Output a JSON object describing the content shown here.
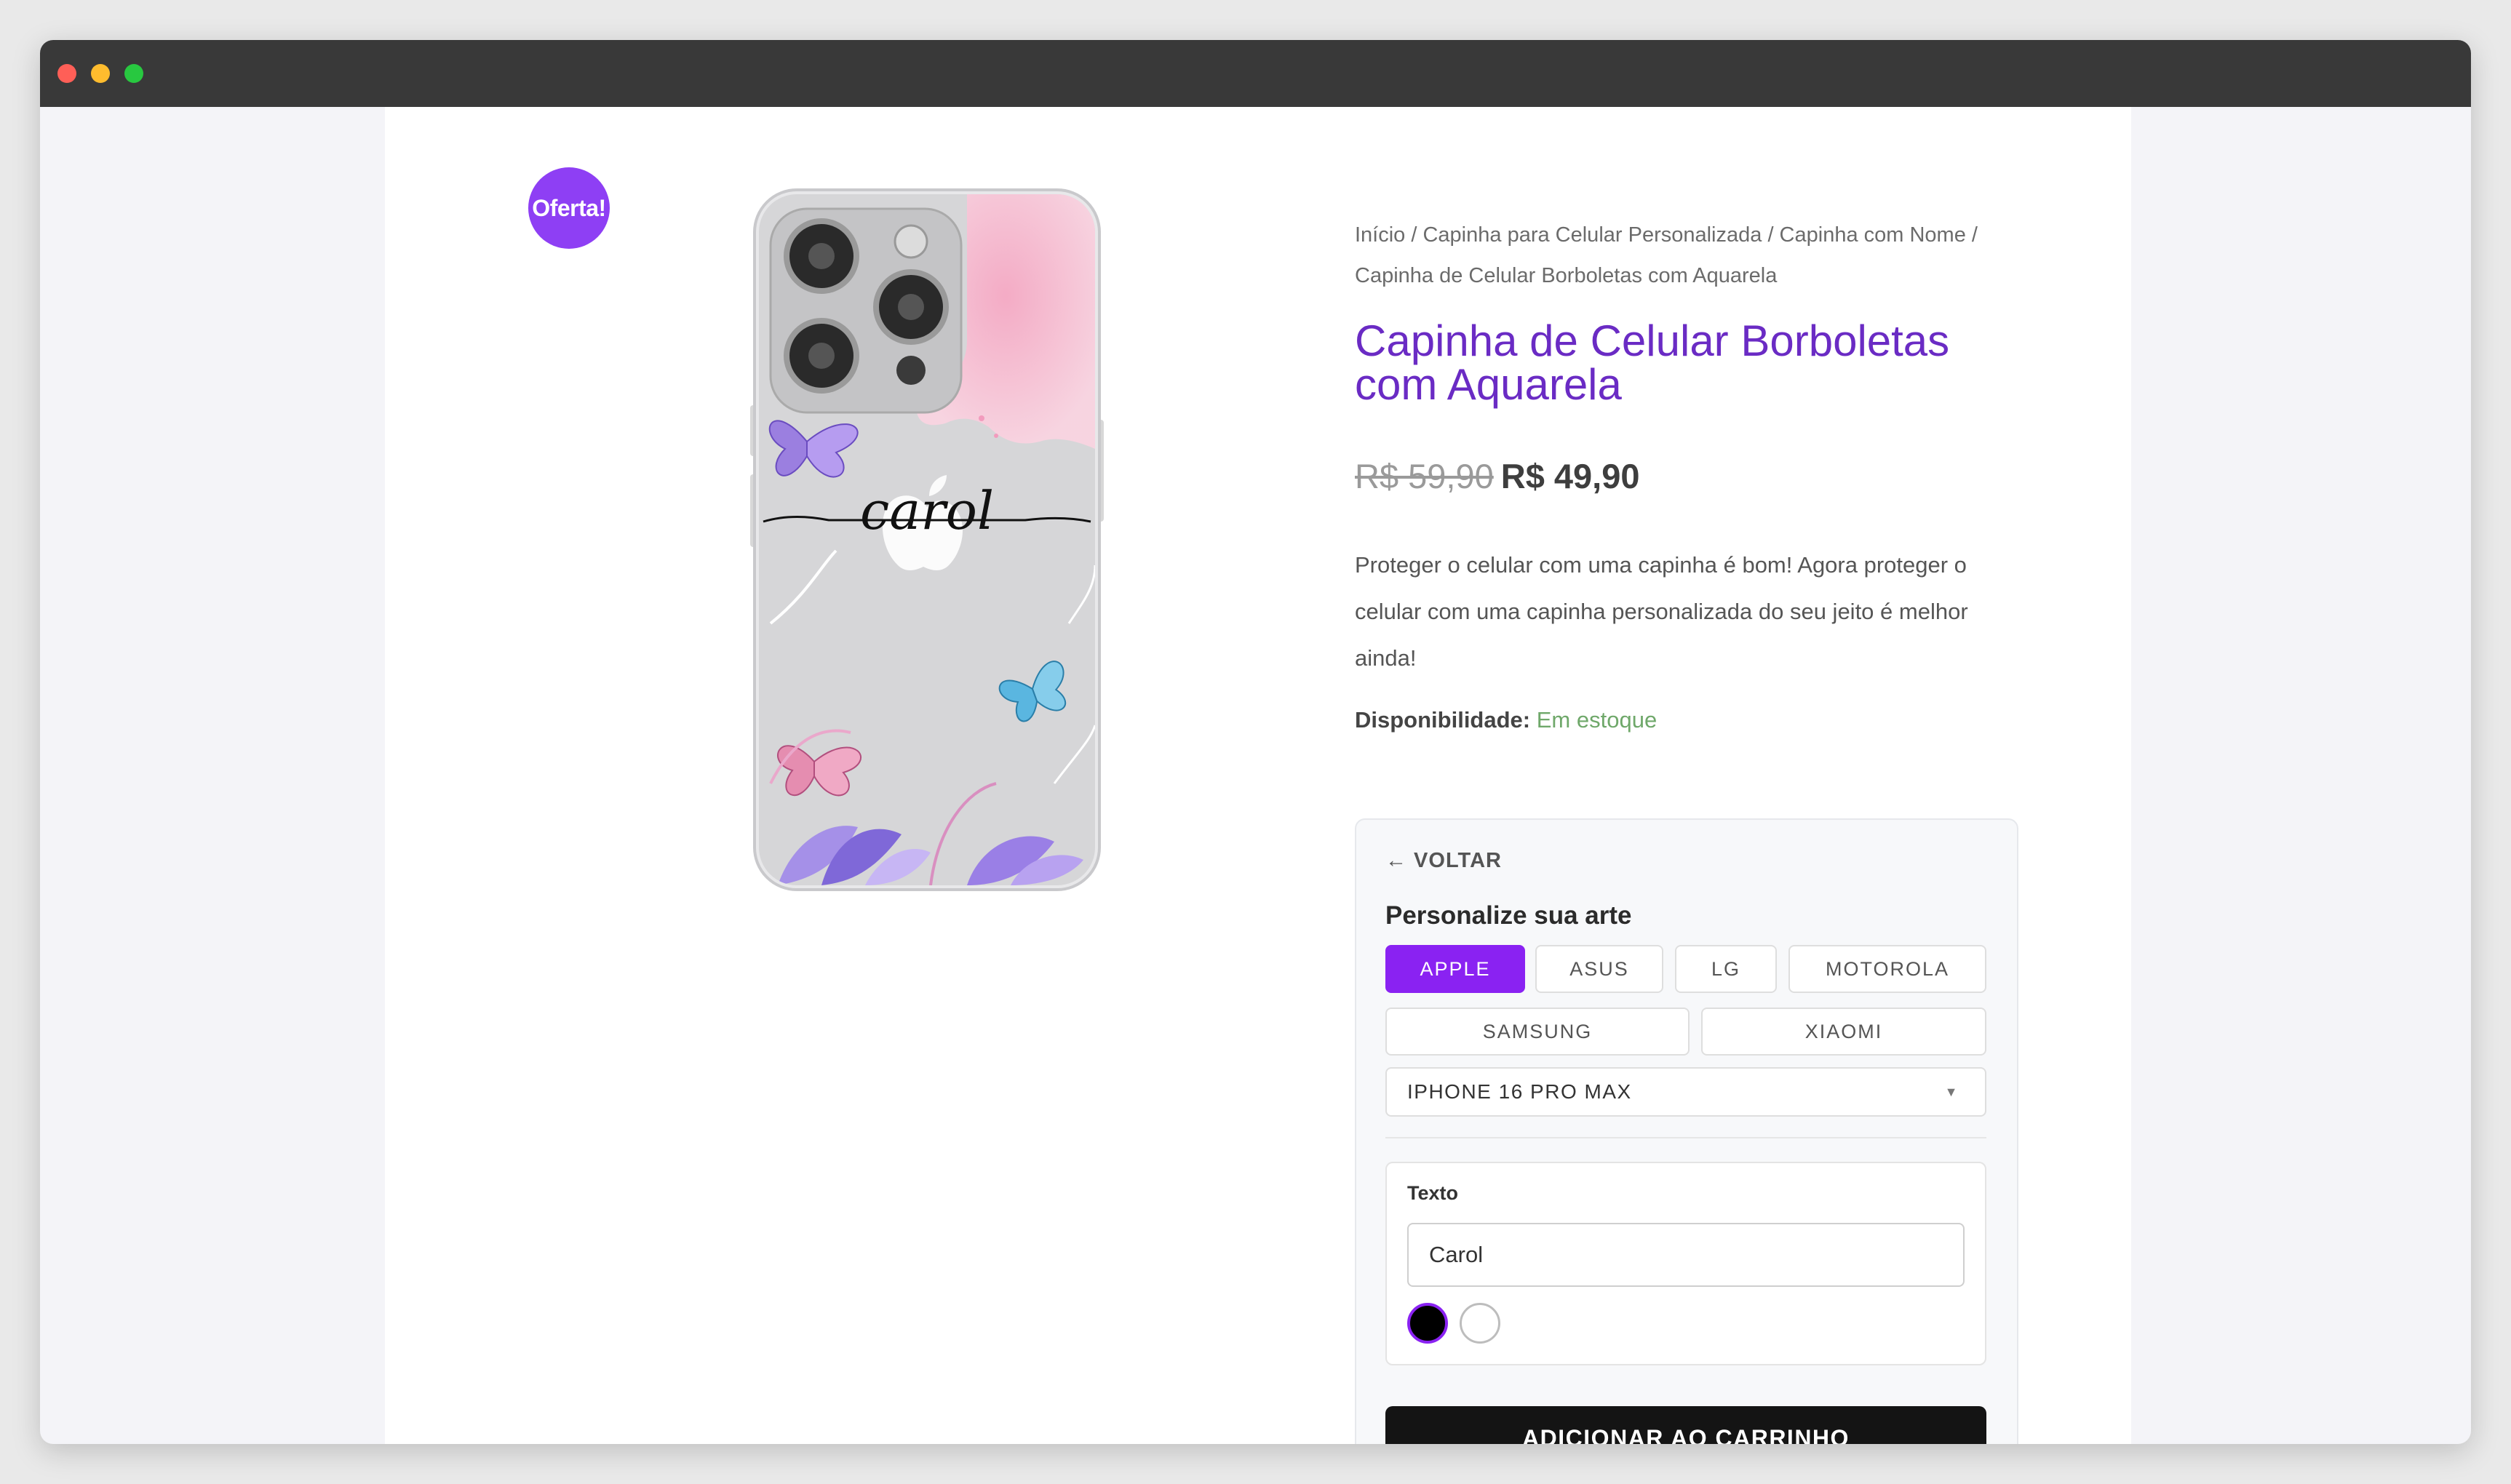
{
  "product": {
    "badge": "Oferta!",
    "breadcrumb": "Início / Capinha para Celular Personalizada / Capinha com Nome / Capinha de Celular Borboletas com Aquarela",
    "title": "Capinha de Celular Borboletas com Aquarela",
    "price_old": "R$ 59,90",
    "price_new": "R$ 49,90",
    "description": "Proteger o celular com uma capinha é bom! Agora proteger o celular com uma capinha personalizada do seu jeito é melhor ainda!",
    "availability_label": "Disponibilidade:",
    "availability_value": "Em estoque",
    "case_name_text": "carol"
  },
  "customizer": {
    "back_label": "← VOLTAR",
    "title": "Personalize sua arte",
    "brands": [
      "APPLE",
      "ASUS",
      "LG",
      "MOTOROLA",
      "SAMSUNG",
      "XIAOMI"
    ],
    "selected_brand": "APPLE",
    "model_selected": "IPHONE 16 PRO MAX",
    "text_label": "Texto",
    "text_value": "Carol",
    "colors": [
      "#000000",
      "#ffffff"
    ],
    "selected_color": "#000000",
    "add_to_cart_label": "ADICIONAR AO CARRINHO"
  },
  "theme": {
    "accent": "#8a22f2",
    "title_color": "#6a2bc4",
    "stock_color": "#6fa86a"
  }
}
